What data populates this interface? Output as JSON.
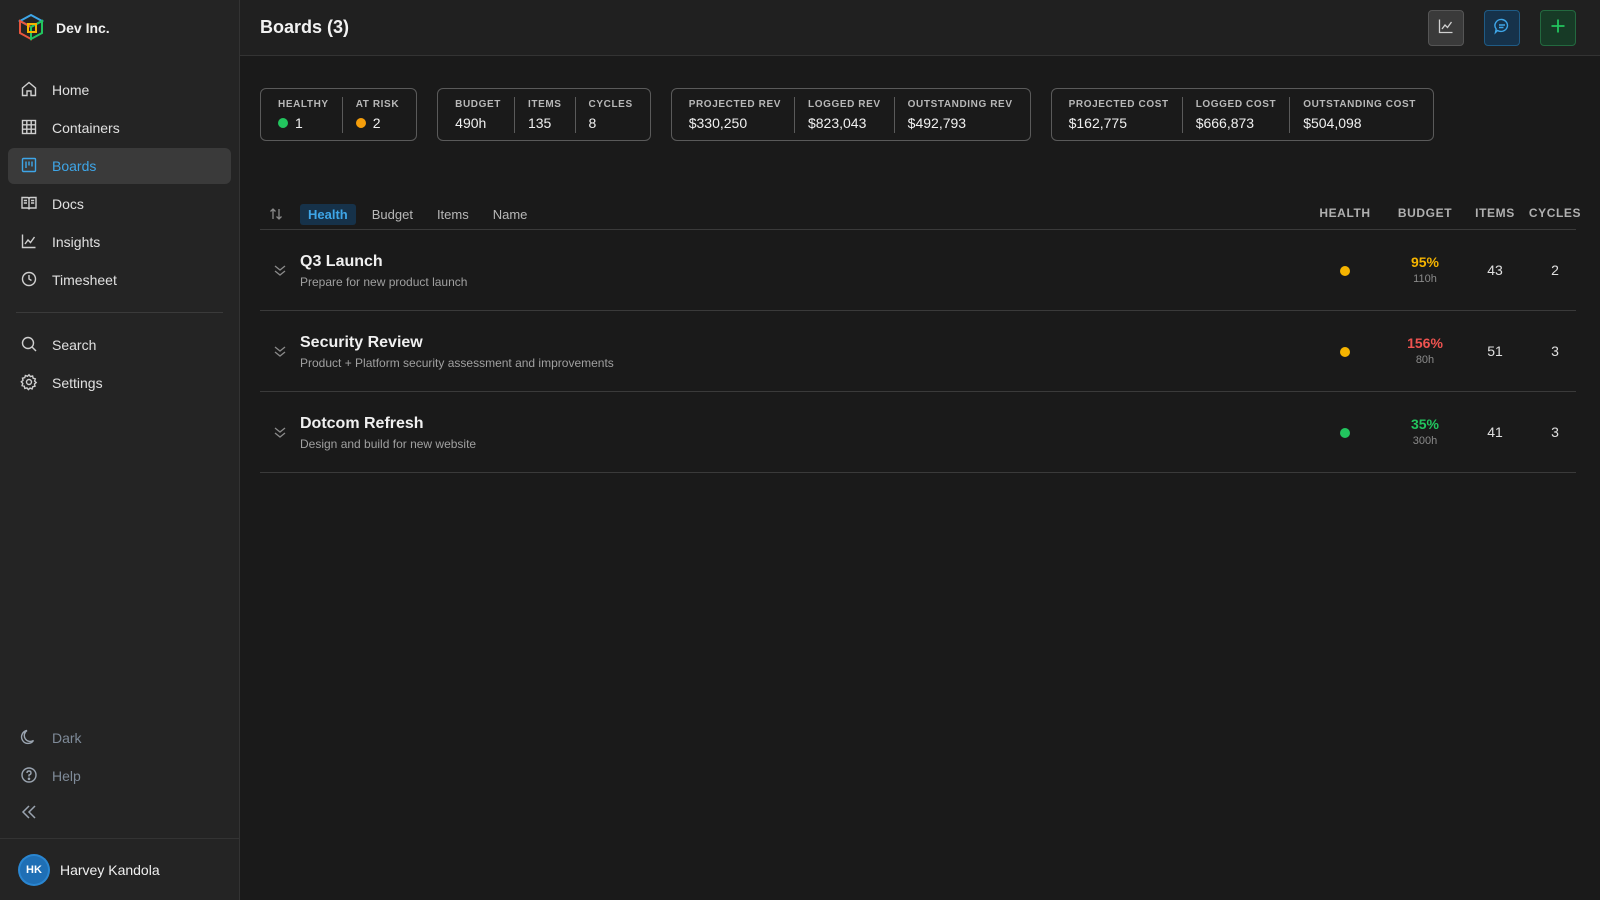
{
  "org": {
    "name": "Dev Inc."
  },
  "nav": {
    "items": [
      {
        "label": "Home",
        "icon": "home-icon"
      },
      {
        "label": "Containers",
        "icon": "grid-icon"
      },
      {
        "label": "Boards",
        "icon": "board-icon",
        "active": true
      },
      {
        "label": "Docs",
        "icon": "book-icon"
      },
      {
        "label": "Insights",
        "icon": "chart-icon"
      },
      {
        "label": "Timesheet",
        "icon": "clock-icon"
      }
    ],
    "secondary": [
      {
        "label": "Search",
        "icon": "search-icon"
      },
      {
        "label": "Settings",
        "icon": "gear-icon"
      }
    ],
    "bottom": [
      {
        "label": "Dark",
        "icon": "moon-icon"
      },
      {
        "label": "Help",
        "icon": "help-icon"
      }
    ]
  },
  "user": {
    "initials": "HK",
    "name": "Harvey Kandola"
  },
  "header": {
    "title": "Boards (3)"
  },
  "stats": {
    "health": [
      {
        "label": "HEALTHY",
        "value": "1",
        "color": "#22c55e"
      },
      {
        "label": "AT RISK",
        "value": "2",
        "color": "#f59e0b"
      }
    ],
    "work": [
      {
        "label": "BUDGET",
        "value": "490h"
      },
      {
        "label": "ITEMS",
        "value": "135"
      },
      {
        "label": "CYCLES",
        "value": "8"
      }
    ],
    "revenue": [
      {
        "label": "PROJECTED REV",
        "value": "$330,250"
      },
      {
        "label": "LOGGED REV",
        "value": "$823,043"
      },
      {
        "label": "OUTSTANDING REV",
        "value": "$492,793"
      }
    ],
    "cost": [
      {
        "label": "PROJECTED COST",
        "value": "$162,775"
      },
      {
        "label": "LOGGED COST",
        "value": "$666,873"
      },
      {
        "label": "OUTSTANDING COST",
        "value": "$504,098"
      }
    ]
  },
  "sort": {
    "options": [
      "Health",
      "Budget",
      "Items",
      "Name"
    ],
    "active": "Health"
  },
  "columns": {
    "health": "HEALTH",
    "budget": "BUDGET",
    "items": "ITEMS",
    "cycles": "CYCLES"
  },
  "boards": [
    {
      "title": "Q3 Launch",
      "description": "Prepare for new product launch",
      "health_color": "#f5b400",
      "budget_pct": "95%",
      "budget_color": "#f5b400",
      "budget_hours": "110h",
      "items": "43",
      "cycles": "2"
    },
    {
      "title": "Security Review",
      "description": "Product + Platform security assessment and improvements",
      "health_color": "#f5b400",
      "budget_pct": "156%",
      "budget_color": "#ef5350",
      "budget_hours": "80h",
      "items": "51",
      "cycles": "3"
    },
    {
      "title": "Dotcom Refresh",
      "description": "Design and build for new website",
      "health_color": "#22c55e",
      "budget_pct": "35%",
      "budget_color": "#22c55e",
      "budget_hours": "300h",
      "items": "41",
      "cycles": "3"
    }
  ],
  "colors": {
    "accent": "#3ea6e8",
    "background": "#1a1a1a",
    "sidebar": "#242424"
  }
}
